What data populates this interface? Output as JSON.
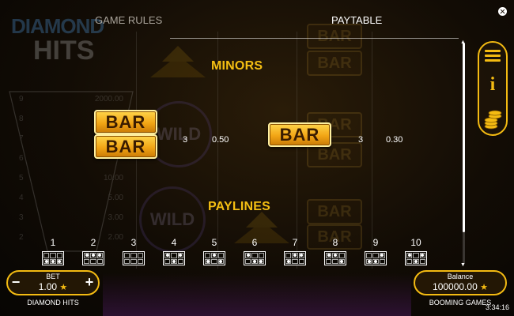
{
  "header": {
    "tab_rules": "GAME RULES",
    "tab_paytable": "PAYTABLE"
  },
  "minors": {
    "title": "MINORS",
    "entries": [
      {
        "symbol": "BAR BAR",
        "tiles": [
          "BAR",
          "BAR"
        ],
        "count": "3",
        "value": "0.50"
      },
      {
        "symbol": "BAR",
        "tiles": [
          "BAR"
        ],
        "count": "3",
        "value": "0.30"
      }
    ]
  },
  "paylines": {
    "title": "PAYLINES",
    "items": [
      {
        "num": "1",
        "pattern": [
          0,
          0,
          0,
          1,
          1,
          1
        ]
      },
      {
        "num": "2",
        "pattern": [
          1,
          1,
          1,
          0,
          0,
          0
        ]
      },
      {
        "num": "3",
        "pattern": [
          0,
          0,
          0,
          0,
          0,
          0
        ]
      },
      {
        "num": "4",
        "pattern": [
          1,
          0,
          1,
          0,
          1,
          0
        ]
      },
      {
        "num": "5",
        "pattern": [
          0,
          1,
          0,
          1,
          0,
          1
        ]
      },
      {
        "num": "6",
        "pattern": [
          1,
          0,
          0,
          0,
          1,
          1
        ]
      },
      {
        "num": "7",
        "pattern": [
          0,
          1,
          1,
          1,
          0,
          0
        ]
      },
      {
        "num": "8",
        "pattern": [
          1,
          1,
          0,
          0,
          0,
          1
        ]
      },
      {
        "num": "9",
        "pattern": [
          0,
          0,
          1,
          1,
          1,
          0
        ]
      },
      {
        "num": "10",
        "pattern": [
          1,
          0,
          1,
          0,
          1,
          0
        ]
      }
    ]
  },
  "background": {
    "logo_line1": "DIAMOND",
    "logo_line2": "HITS",
    "pay_rows": [
      {
        "n": "9",
        "v": "2000.00"
      },
      {
        "n": "8",
        "v": ""
      },
      {
        "n": "7",
        "v": ""
      },
      {
        "n": "6",
        "v": ""
      },
      {
        "n": "5",
        "v": "10.00"
      },
      {
        "n": "4",
        "v": "5.00"
      },
      {
        "n": "3",
        "v": "3.00"
      },
      {
        "n": "2",
        "v": "2.00"
      }
    ],
    "bar_label": "BAR",
    "wild_label": "WILD"
  },
  "bet": {
    "label": "BET",
    "value": "1.00",
    "minus": "−",
    "plus": "+",
    "game_name": "DIAMOND HITS"
  },
  "balance": {
    "label": "Balance",
    "value": "100000.00",
    "provider": "BOOMING GAMES"
  },
  "clock": "3:34:16",
  "icons": {
    "close": "close-icon",
    "menu": "hamburger-menu-icon",
    "info": "info-icon",
    "coins": "coins-icon",
    "star": "star-icon"
  },
  "colors": {
    "accent": "#f4bb12",
    "title": "#f5bf13",
    "bar_tile": "#f2a515"
  }
}
